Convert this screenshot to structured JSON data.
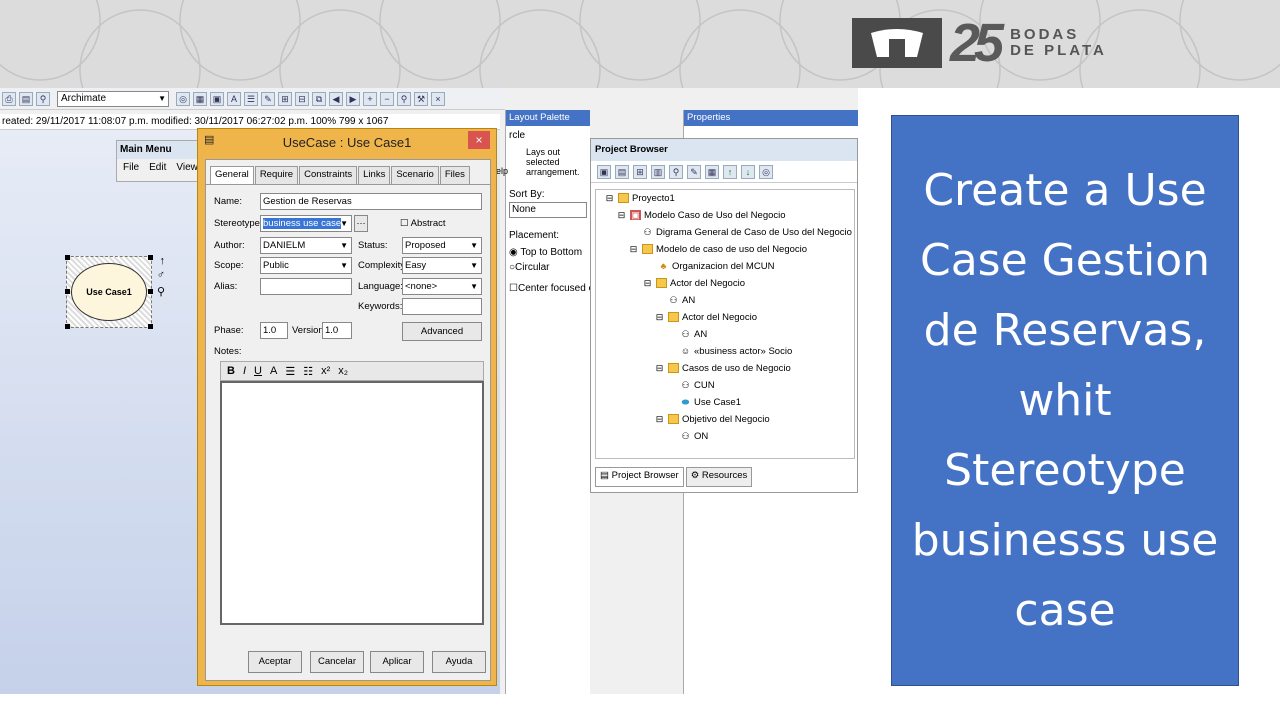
{
  "banner": {
    "logo_number": "25",
    "logo_text_line1": "BODAS",
    "logo_text_line2": "DE PLATA"
  },
  "toolbar": {
    "combo_value": "Archimate"
  },
  "infobar": {
    "text": "reated: 29/11/2017 11:08:07 p.m.  modified: 30/11/2017 06:27:02 p.m.  100%  799 x 1067"
  },
  "canvas": {
    "element_label": "Use Case1"
  },
  "main_menu": {
    "title": "Main Menu",
    "items": [
      "File",
      "Edit",
      "View"
    ]
  },
  "dialog": {
    "title": "UseCase : Use Case1",
    "close": "×",
    "tabs": [
      "General",
      "Require",
      "Constraints",
      "Links",
      "Scenario",
      "Files"
    ],
    "name_label": "Name:",
    "name_value": "Gestion de Reservas",
    "stereotype_label": "Stereotype:",
    "stereotype_value": "business use case",
    "abstract_label": "Abstract",
    "author_label": "Author:",
    "author_value": "DANIELM",
    "status_label": "Status:",
    "status_value": "Proposed",
    "scope_label": "Scope:",
    "scope_value": "Public",
    "complexity_label": "Complexity:",
    "complexity_value": "Easy",
    "alias_label": "Alias:",
    "language_label": "Language:",
    "language_value": "<none>",
    "keywords_label": "Keywords:",
    "phase_label": "Phase:",
    "phase_value": "1.0",
    "version_label": "Version:",
    "version_value": "1.0",
    "advanced_label": "Advanced",
    "notes_label": "Notes:",
    "ok": "Aceptar",
    "cancel": "Cancelar",
    "apply": "Aplicar",
    "help": "Ayuda"
  },
  "palette": {
    "title": "Layout Palette",
    "item": "rcle",
    "desc": "Lays out selected arrangement.",
    "sort_label": "Sort By:",
    "sort_value": "None",
    "placement_label": "Placement:",
    "opt1": "Top to Bottom",
    "opt2": "Circular",
    "center": "Center focused ele",
    "help": "elp"
  },
  "properties": {
    "title": "Properties"
  },
  "project_browser": {
    "title": "Project Browser",
    "nodes": [
      "Proyecto1",
      "Modelo Caso de Uso del Negocio",
      "Digrama General de Caso de Uso del Negocio",
      "Modelo de caso de uso del Negocio",
      "Organizacion del MCUN",
      "Actor del Negocio",
      "AN",
      "Actor del Negocio",
      "AN",
      "«business actor» Socio",
      "Casos de uso de Negocio",
      "CUN",
      "Use Case1",
      "Objetivo del Negocio",
      "ON"
    ],
    "tab_browser": "Project Browser",
    "tab_resources": "Resources"
  },
  "slide_text": "Create a Use Case Gestion de Reservas, whit Stereotype businesss use case"
}
